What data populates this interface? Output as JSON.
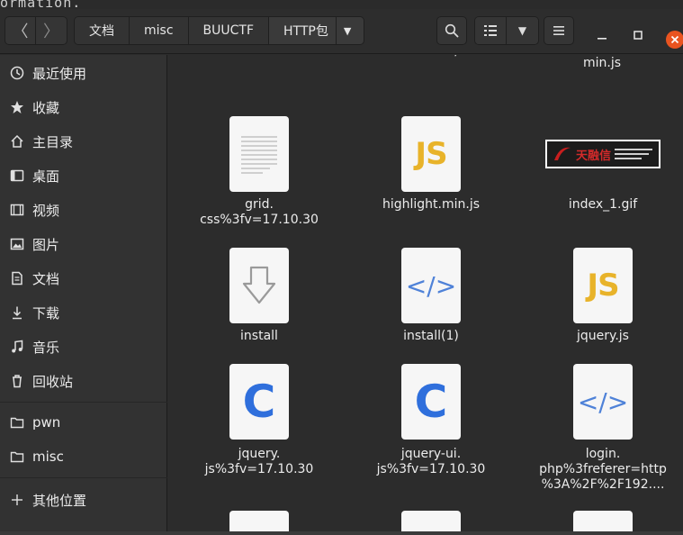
{
  "terminal": {
    "text": "ormation."
  },
  "nav": {
    "back": "〈",
    "forward": "〉"
  },
  "breadcrumb": {
    "items": [
      "文档",
      "misc",
      "BUUCTF",
      "HTTP包"
    ],
    "dropdown": "▼"
  },
  "toolbar": {
    "view_dropdown": "▼"
  },
  "sidebar": {
    "items": [
      {
        "label": "最近使用",
        "icon": "clock-icon"
      },
      {
        "label": "收藏",
        "icon": "star-icon"
      },
      {
        "label": "主目录",
        "icon": "home-icon"
      },
      {
        "label": "桌面",
        "icon": "desktop-icon"
      },
      {
        "label": "视频",
        "icon": "video-icon"
      },
      {
        "label": "图片",
        "icon": "picture-icon"
      },
      {
        "label": "文档",
        "icon": "document-icon"
      },
      {
        "label": "下载",
        "icon": "download-icon"
      },
      {
        "label": "音乐",
        "icon": "music-icon"
      },
      {
        "label": "回收站",
        "icon": "trash-icon"
      },
      {
        "label": "pwn",
        "icon": "folder-icon"
      },
      {
        "label": "misc",
        "icon": "folder-icon"
      },
      {
        "label": "其他位置",
        "icon": "plus-icon"
      }
    ]
  },
  "files": {
    "top_partial": [
      ".../",
      "min.js"
    ],
    "items": [
      {
        "name": "grid.\ncss%3fv=17.10.30",
        "type": "text"
      },
      {
        "name": "highlight.min.js",
        "type": "js",
        "glyph": "JS"
      },
      {
        "name": "index_1.gif",
        "type": "gif",
        "badge": "天融信"
      },
      {
        "name": "install",
        "type": "install"
      },
      {
        "name": "install(1)",
        "type": "code",
        "glyph": "</>"
      },
      {
        "name": "jquery.js",
        "type": "js",
        "glyph": "JS"
      },
      {
        "name": "jquery.\njs%3fv=17.10.30",
        "type": "c",
        "glyph": "C"
      },
      {
        "name": "jquery-ui.\njs%3fv=17.10.30",
        "type": "c",
        "glyph": "C"
      },
      {
        "name": "login.\nphp%3freferer=http\n%3A%2F%2F192....",
        "type": "code",
        "glyph": "</>"
      }
    ]
  },
  "colors": {
    "js": "#e8b32a",
    "code": "#4f82d8",
    "c": "#2f6fdc",
    "close": "#e95420"
  }
}
